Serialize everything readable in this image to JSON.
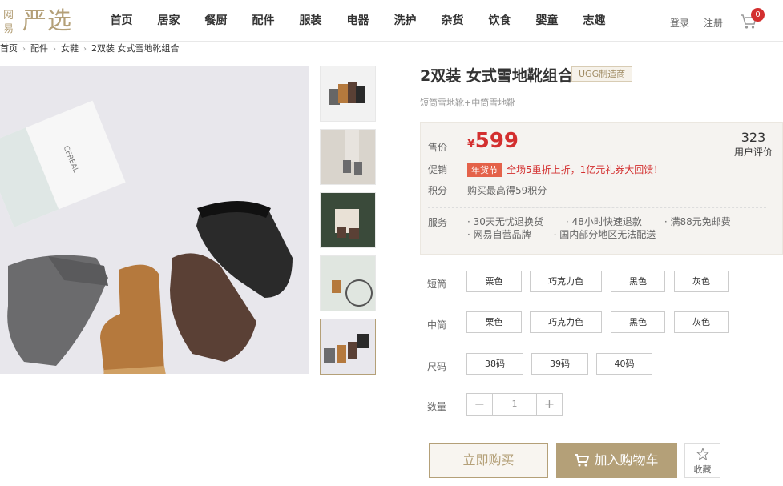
{
  "logo": {
    "small_text": "网易",
    "big_text": "严选"
  },
  "nav": [
    "首页",
    "居家",
    "餐厨",
    "配件",
    "服装",
    "电器",
    "洗护",
    "杂货",
    "饮食",
    "婴童",
    "志趣"
  ],
  "header": {
    "login": "登录",
    "register": "注册",
    "cart_count": "0"
  },
  "breadcrumb": [
    "首页",
    "配件",
    "女鞋",
    "2双装 女式雪地靴组合"
  ],
  "product": {
    "title": "2双装 女式雪地靴组合",
    "brand_tag": "UGG制造商",
    "subtitle": "短筒雪地靴+中筒雪地靴",
    "price_label": "售价",
    "currency": "¥",
    "price": "599",
    "review_count": "323",
    "review_label": "用户评价",
    "promo_label": "促销",
    "promo_tag": "年货节",
    "promo_text": "全场5重折上折，1亿元礼券大回馈！",
    "points_label": "积分",
    "points_text": "购买最高得59积分",
    "service_label": "服务",
    "services": [
      "30天无忧退换货",
      "48小时快速退款",
      "满88元免邮费",
      "网易自营品牌",
      "国内部分地区无法配送"
    ]
  },
  "options": {
    "short_label": "短筒",
    "short_colors": [
      "栗色",
      "巧克力色",
      "黑色",
      "灰色"
    ],
    "mid_label": "中筒",
    "mid_colors": [
      "栗色",
      "巧克力色",
      "黑色",
      "灰色"
    ],
    "size_label": "尺码",
    "sizes": [
      "38码",
      "39码",
      "40码"
    ],
    "qty_label": "数量",
    "qty_minus": "−",
    "qty_value": "1",
    "qty_plus": "+"
  },
  "actions": {
    "buy_now": "立即购买",
    "add_cart": "加入购物车",
    "favorite": "收藏"
  },
  "colors": {
    "accent": "#b4a078",
    "price_red": "#d32f2f",
    "promo_tag": "#e4624a"
  }
}
